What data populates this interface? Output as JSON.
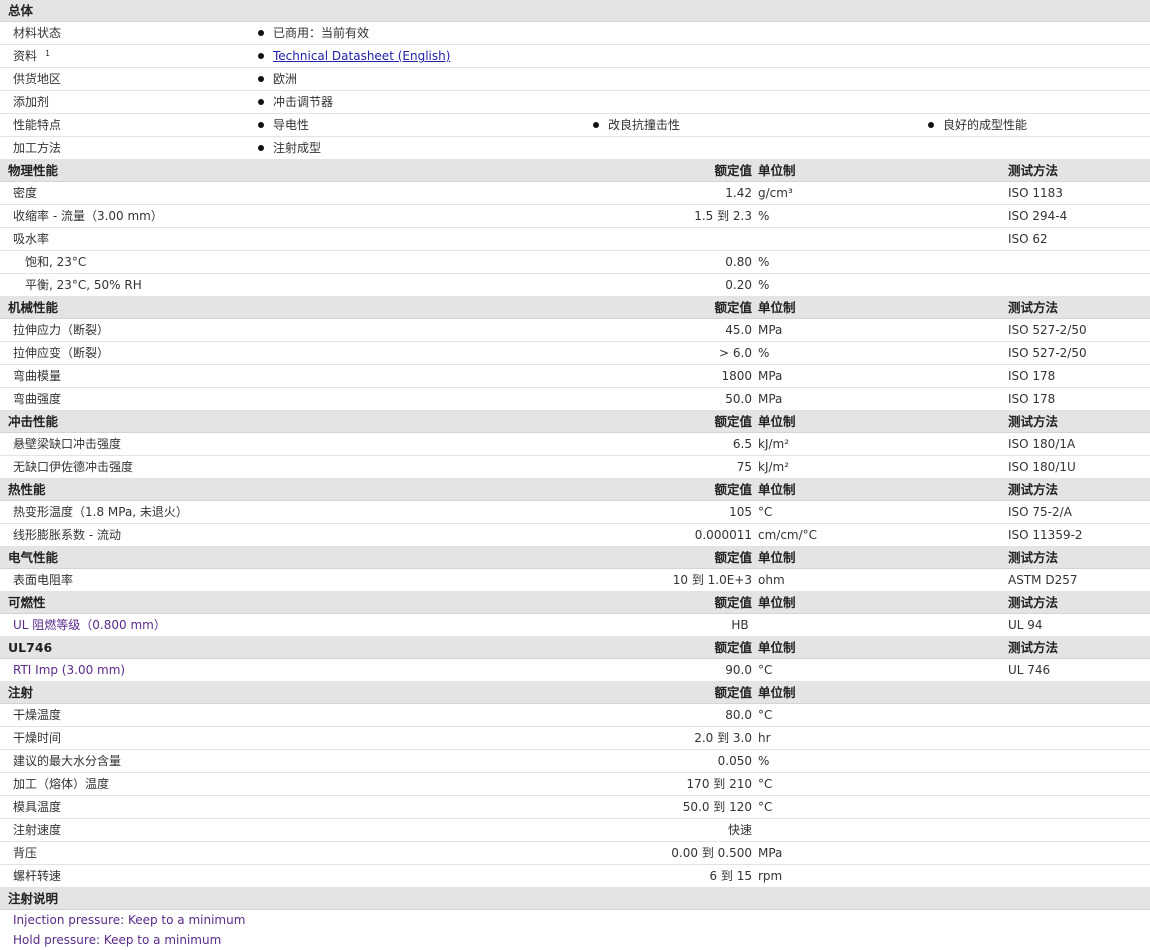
{
  "general": {
    "title": "总体",
    "rows": [
      {
        "label": "材料状态",
        "values": [
          "已商用：当前有效"
        ]
      },
      {
        "label": "资料",
        "sup": "1",
        "link": "Technical Datasheet (English)"
      },
      {
        "label": "供货地区",
        "values": [
          "欧洲"
        ]
      },
      {
        "label": "添加剂",
        "values": [
          "冲击调节器"
        ]
      },
      {
        "label": "性能特点",
        "values": [
          "导电性",
          "改良抗撞击性",
          "良好的成型性能"
        ]
      },
      {
        "label": "加工方法",
        "values": [
          "注射成型"
        ]
      }
    ]
  },
  "col": {
    "rated": "额定值",
    "unit": "单位制",
    "test": "测试方法"
  },
  "physical": {
    "title": "物理性能",
    "rows": [
      {
        "label": "密度",
        "value": "1.42",
        "unit": "g/cm³",
        "test": "ISO 1183"
      },
      {
        "label": "收缩率 - 流量（3.00 mm）",
        "value": "1.5 到 2.3",
        "unit": "%",
        "test": "ISO 294-4"
      },
      {
        "label": "吸水率",
        "value": "",
        "unit": "",
        "test": "ISO 62"
      },
      {
        "label": "饱和, 23°C",
        "sub": true,
        "value": "0.80",
        "unit": "%",
        "test": ""
      },
      {
        "label": "平衡, 23°C, 50% RH",
        "sub": true,
        "value": "0.20",
        "unit": "%",
        "test": ""
      }
    ]
  },
  "mechanical": {
    "title": "机械性能",
    "rows": [
      {
        "label": "拉伸应力（断裂）",
        "value": "45.0",
        "unit": "MPa",
        "test": "ISO 527-2/50"
      },
      {
        "label": "拉伸应变（断裂）",
        "value": "> 6.0",
        "unit": "%",
        "test": "ISO 527-2/50"
      },
      {
        "label": "弯曲模量",
        "value": "1800",
        "unit": "MPa",
        "test": "ISO 178"
      },
      {
        "label": "弯曲强度",
        "value": "50.0",
        "unit": "MPa",
        "test": "ISO 178"
      }
    ]
  },
  "impact": {
    "title": "冲击性能",
    "rows": [
      {
        "label": "悬壁梁缺口冲击强度",
        "value": "6.5",
        "unit": "kJ/m²",
        "test": "ISO 180/1A"
      },
      {
        "label": "无缺口伊佐德冲击强度",
        "value": "75",
        "unit": "kJ/m²",
        "test": "ISO 180/1U"
      }
    ]
  },
  "thermal": {
    "title": "热性能",
    "rows": [
      {
        "label": "热变形温度（1.8 MPa, 未退火）",
        "value": "105",
        "unit": "°C",
        "test": "ISO 75-2/A"
      },
      {
        "label": "线形膨胀系数 - 流动",
        "value": "0.000011",
        "unit": "cm/cm/°C",
        "test": "ISO 11359-2"
      }
    ]
  },
  "electrical": {
    "title": "电气性能",
    "rows": [
      {
        "label": "表面电阻率",
        "value": "10 到 1.0E+3",
        "unit": "ohm",
        "test": "ASTM D257"
      }
    ]
  },
  "flammability": {
    "title": "可燃性",
    "rows": [
      {
        "label": "UL 阻燃等级（0.800 mm）",
        "value": "HB",
        "center": true,
        "unit": "",
        "test": "UL 94",
        "purple": true
      }
    ]
  },
  "ul746": {
    "title": "UL746",
    "rows": [
      {
        "label": "RTI Imp (3.00 mm)",
        "value": "90.0",
        "unit": "°C",
        "test": "UL 746",
        "purple": true
      }
    ]
  },
  "injection": {
    "title": "注射",
    "rows": [
      {
        "label": "干燥温度",
        "value": "80.0",
        "unit": "°C"
      },
      {
        "label": "干燥时间",
        "value": "2.0 到 3.0",
        "unit": "hr"
      },
      {
        "label": "建议的最大水分含量",
        "value": "0.050",
        "unit": "%"
      },
      {
        "label": "加工（熔体）温度",
        "value": "170 到 210",
        "unit": "°C"
      },
      {
        "label": "模具温度",
        "value": "50.0 到 120",
        "unit": "°C"
      },
      {
        "label": "注射速度",
        "value": "快速",
        "center": true,
        "unit": ""
      },
      {
        "label": "背压",
        "value": "0.00 到 0.500",
        "unit": "MPa"
      },
      {
        "label": "螺杆转速",
        "value": "6 到 15",
        "unit": "rpm"
      }
    ]
  },
  "notes": {
    "title": "注射说明",
    "lines": [
      "Injection pressure: Keep to a minimum",
      "Hold pressure: Keep to a minimum"
    ]
  }
}
